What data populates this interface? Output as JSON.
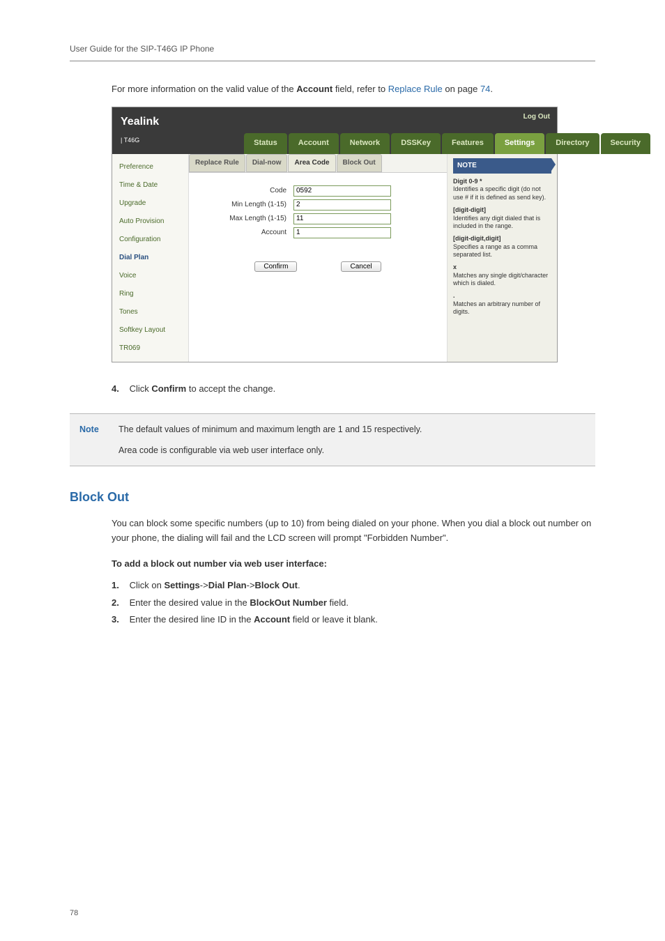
{
  "header": {
    "title": "User Guide for the SIP-T46G IP Phone"
  },
  "intro": {
    "pre_text": "For more information on the valid value of the ",
    "bold1": "Account",
    "mid_text": " field, refer to ",
    "link": "Replace Rule",
    "post_text": " on page ",
    "page_ref": "74",
    "period": "."
  },
  "screenshot": {
    "logo_main": "Yealink",
    "logo_sub": "T46G",
    "logout": "Log Out",
    "tabs": [
      "Status",
      "Account",
      "Network",
      "DSSKey",
      "Features",
      "Settings",
      "Directory",
      "Security"
    ],
    "tab_active_index": 5,
    "sidebar": [
      "Preference",
      "Time & Date",
      "Upgrade",
      "Auto Provision",
      "Configuration",
      "Dial Plan",
      "Voice",
      "Ring",
      "Tones",
      "Softkey Layout",
      "TR069"
    ],
    "sidebar_active_index": 5,
    "subtabs": [
      "Replace Rule",
      "Dial-now",
      "Area Code",
      "Block Out"
    ],
    "subtab_active_index": 2,
    "fields": {
      "code_label": "Code",
      "code_value": "0592",
      "min_label": "Min Length (1-15)",
      "min_value": "2",
      "max_label": "Max Length (1-15)",
      "max_value": "11",
      "account_label": "Account",
      "account_value": "1"
    },
    "buttons": {
      "confirm": "Confirm",
      "cancel": "Cancel"
    },
    "note": {
      "title": "NOTE",
      "p1b": "Digit 0-9 *",
      "p1": "Identifies a specific digit (do not use # if it is defined as send key).",
      "p2b": "[digit-digit]",
      "p2": "Identifies any digit dialed that is included in the range.",
      "p3b": "[digit-digit,digit]",
      "p3": "Specifies a range as a comma separated list.",
      "p4b": "x",
      "p4": "Matches any single digit/character which is dialed.",
      "p5b": ".",
      "p5": "Matches an arbitrary number of digits."
    }
  },
  "step4": {
    "num": "4.",
    "pre": "Click ",
    "bold": "Confirm",
    "post": " to accept the change."
  },
  "notebox": {
    "label": "Note",
    "line1": "The default values of minimum and maximum length are 1 and 15 respectively.",
    "line2": "Area code is configurable via web user interface only."
  },
  "section": {
    "title": "Block Out"
  },
  "section_para": "You can block some specific numbers (up to 10) from being dialed on your phone. When you dial a block out number on your phone, the dialing will fail and the LCD screen will prompt \"Forbidden Number\".",
  "subhead": "To add a block out number via web user interface:",
  "steps": {
    "s1": {
      "num": "1.",
      "pre": "Click on ",
      "b1": "Settings",
      "sep1": "->",
      "b2": "Dial Plan",
      "sep2": "->",
      "b3": "Block Out",
      "post": "."
    },
    "s2": {
      "num": "2.",
      "pre": "Enter the desired value in the ",
      "b1": "BlockOut Number",
      "post": " field."
    },
    "s3": {
      "num": "3.",
      "pre": "Enter the desired line ID in the ",
      "b1": "Account",
      "post": " field or leave it blank."
    }
  },
  "page_number": "78"
}
